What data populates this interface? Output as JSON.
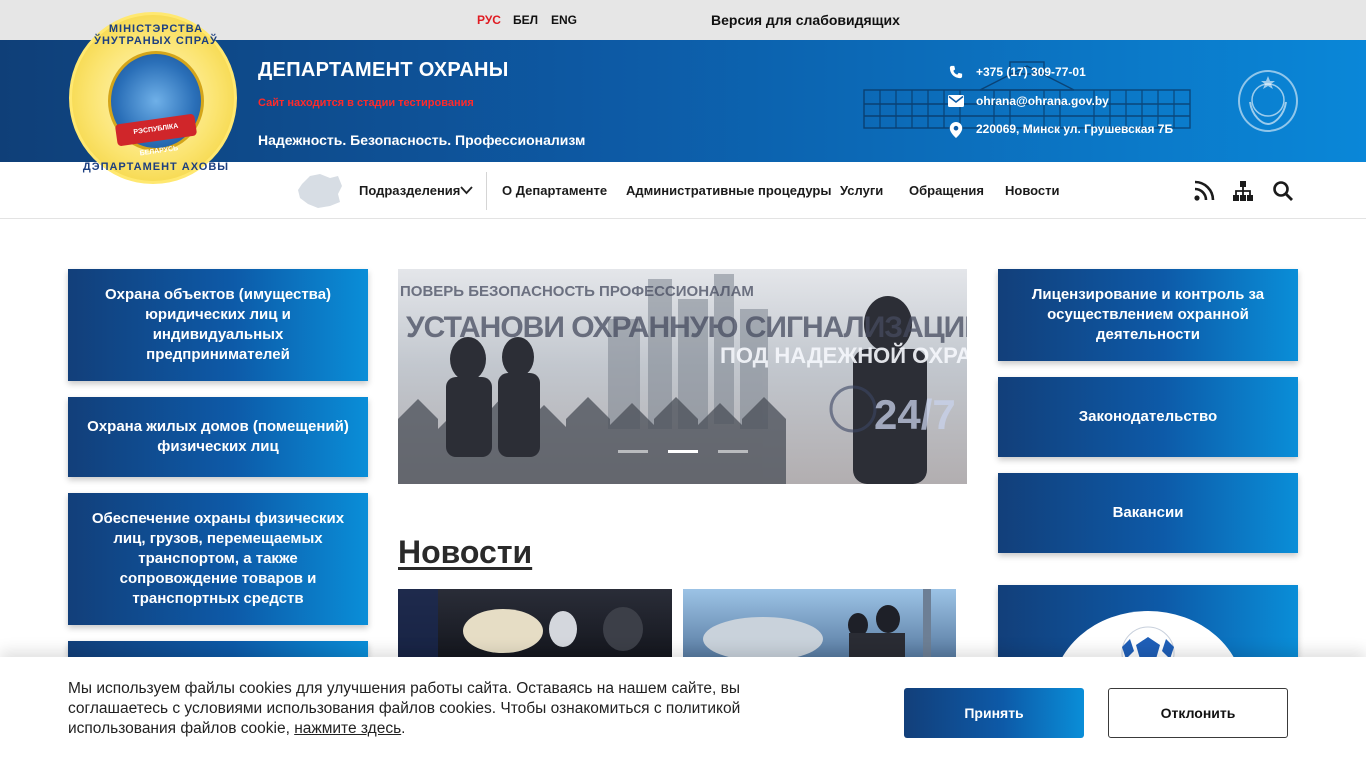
{
  "topbar": {
    "languages": [
      "РУС",
      "БЕЛ",
      "ENG"
    ],
    "active_language": "РУС",
    "low_vision_link": "Версия для слабовидящих"
  },
  "header": {
    "emblem_text_top": "МІНІСТЭРСТВА ЎНУТРАНЫХ СПРАЎ",
    "emblem_text_bottom": "ДЭПАРТАМЕНТ АХОВЫ",
    "emblem_ribbon": "РЭСПУБЛІКА БЕЛАРУСЬ",
    "title": "ДЕПАРТАМЕНТ ОХРАНЫ",
    "testing_notice": "Сайт находится в стадии тестирования",
    "slogan": "Надежность. Безопасность. Профессионализм",
    "phone": "+375 (17) 309-77-01",
    "email": "ohrana@ohrana.gov.by",
    "address": "220069, Минск ул. Грушевская 7Б"
  },
  "nav": {
    "items": [
      "Подразделения",
      "О Департаменте",
      "Административные процедуры",
      "Услуги",
      "Обращения",
      "Новости"
    ],
    "tools": [
      "rss-icon",
      "sitemap-icon",
      "search-icon"
    ]
  },
  "left_cards": [
    "Охрана объектов (имущества) юридических лиц и индивидуальных предпринимателей",
    "Охрана жилых домов (помещений) физических лиц",
    "Обеспечение охраны физических лиц, грузов, перемещаемых транспортом, а также сопровождение товаров и транспортных средств"
  ],
  "right_cards": [
    "Лицензирование и контроль за осуществлением охранной деятельности",
    "Законодательство",
    "Вакансии"
  ],
  "slider": {
    "line1": "ПОВЕРЬ БЕЗОПАСНОСТЬ ПРОФЕССИОНАЛАМ",
    "line2": "УСТАНОВИ ОХРАННУЮ СИГНАЛИЗАЦИЮ!",
    "line3": "ПОД НАДЕЖНОЙ ОХРАНОЙ",
    "line4": "24/7",
    "dots": 3,
    "active_dot": 2
  },
  "news": {
    "heading": "Новости"
  },
  "cookie": {
    "text": "Мы используем файлы cookies для улучшения работы сайта. Оставаясь на нашем сайте, вы соглашаетесь с условиями использования файлов cookies. Чтобы ознакомиться с политикой использования файлов cookie, ",
    "link": "нажмите здесь",
    "tail": ".",
    "accept": "Принять",
    "decline": "Отклонить"
  },
  "colors": {
    "header_gradient_start": "#0f3f78",
    "header_gradient_end": "#0a87d8",
    "accent_red": "#e01b22",
    "topbar_bg": "#e6e6e6"
  }
}
